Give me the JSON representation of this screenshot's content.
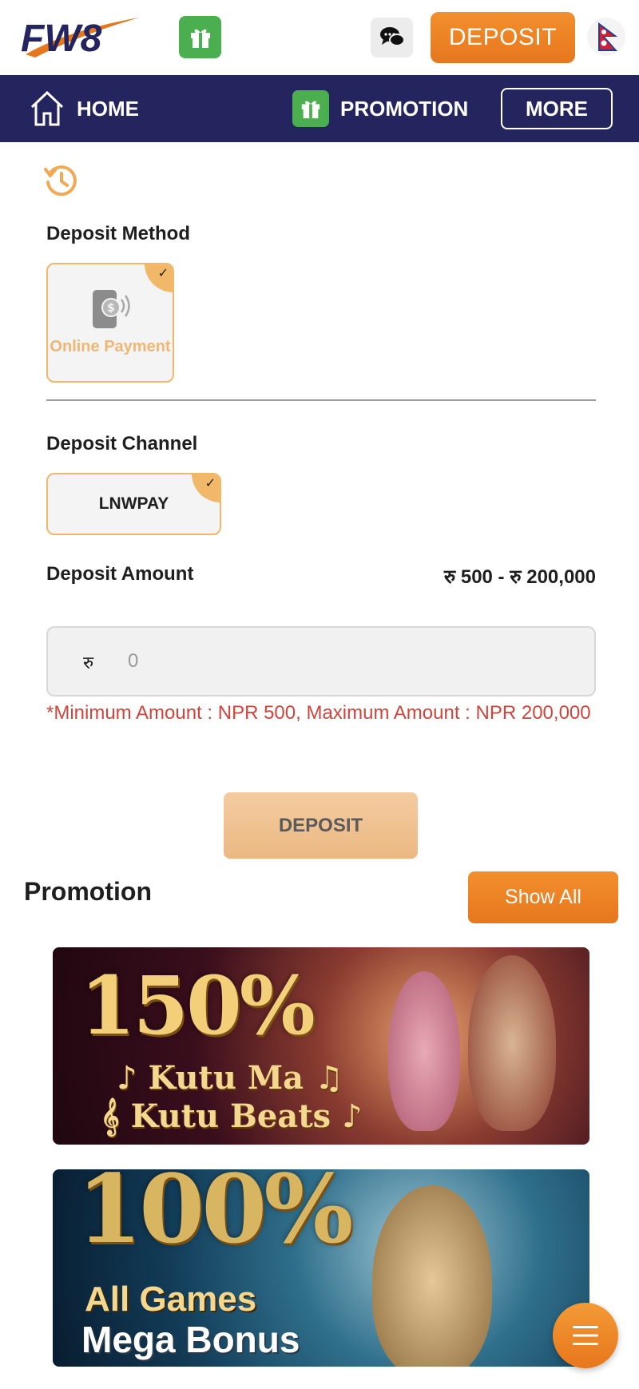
{
  "header": {
    "logo_text": "FW8",
    "deposit_label": "DEPOSIT",
    "icons": {
      "gift": "gift-icon",
      "chat": "chat-bubbles-icon",
      "language": "nepal-flag-icon"
    }
  },
  "nav": {
    "home_label": "HOME",
    "promotion_label": "PROMOTION",
    "more_label": "MORE"
  },
  "deposit": {
    "method_title": "Deposit Method",
    "method_option": "Online Payment",
    "channel_title": "Deposit Channel",
    "channel_option": "LNWPAY",
    "amount_title": "Deposit Amount",
    "amount_range": "रु 500 - रु 200,000",
    "currency_symbol": "रु",
    "amount_placeholder": "0",
    "hint": "*Minimum Amount : NPR 500, Maximum Amount : NPR 200,000",
    "submit_label": "DEPOSIT"
  },
  "promotion": {
    "title": "Promotion",
    "show_all_label": "Show All",
    "banners": [
      {
        "headline": "150%",
        "line1": "♪ Kutu Ma ♫",
        "line2": "𝄞 Kutu Beats ♪"
      },
      {
        "headline": "100%",
        "line1": "All Games",
        "line2": "Mega Bonus"
      }
    ]
  },
  "colors": {
    "brand_orange": "#E7771C",
    "nav_navy": "#24245F",
    "selected_border": "#F0B868",
    "error_red": "#D1453D",
    "gift_green": "#4CAF4F"
  }
}
